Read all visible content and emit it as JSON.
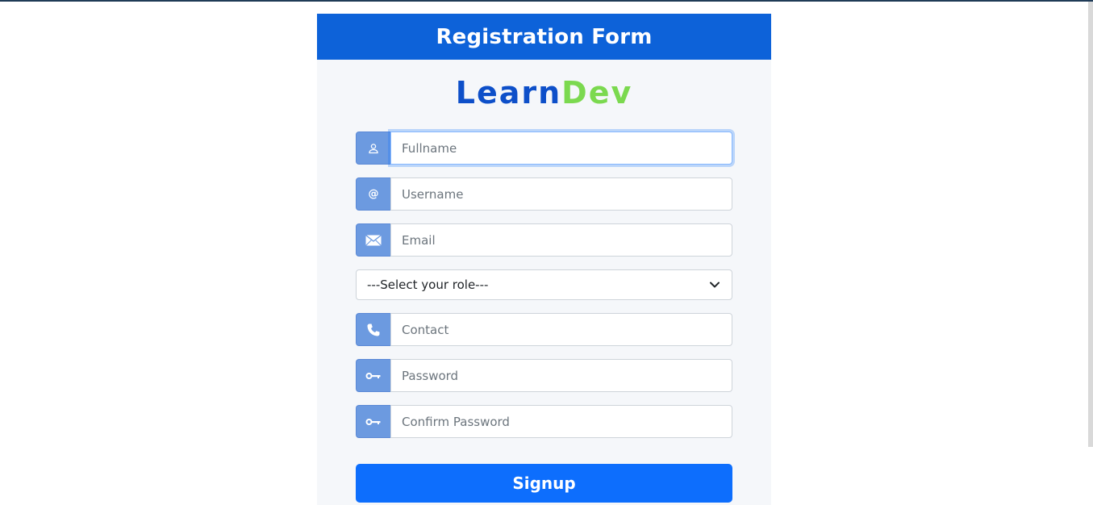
{
  "header": {
    "title": "Registration Form"
  },
  "logo": {
    "part1": "Learn",
    "part2": "Dev",
    "color_learn": "#0d4fc9",
    "color_dev": "#7bd94f"
  },
  "form": {
    "fullname": {
      "placeholder": "Fullname",
      "value": "",
      "icon": "user-icon"
    },
    "username": {
      "placeholder": "Username",
      "value": "",
      "icon": "at-icon",
      "icon_text": "@"
    },
    "email": {
      "placeholder": "Email",
      "value": "",
      "icon": "envelope-icon"
    },
    "role": {
      "selected": "---Select your role---"
    },
    "contact": {
      "placeholder": "Contact",
      "value": "",
      "icon": "phone-icon"
    },
    "password": {
      "placeholder": "Password",
      "value": "",
      "icon": "key-icon"
    },
    "confirm_password": {
      "placeholder": "Confirm Password",
      "value": "",
      "icon": "key-icon"
    },
    "submit_label": "Signup"
  },
  "colors": {
    "header_bg": "#0d62d9",
    "addon_bg": "#6c9ae0",
    "button_bg": "#0d6efd",
    "card_bg": "#f5f7fa"
  }
}
